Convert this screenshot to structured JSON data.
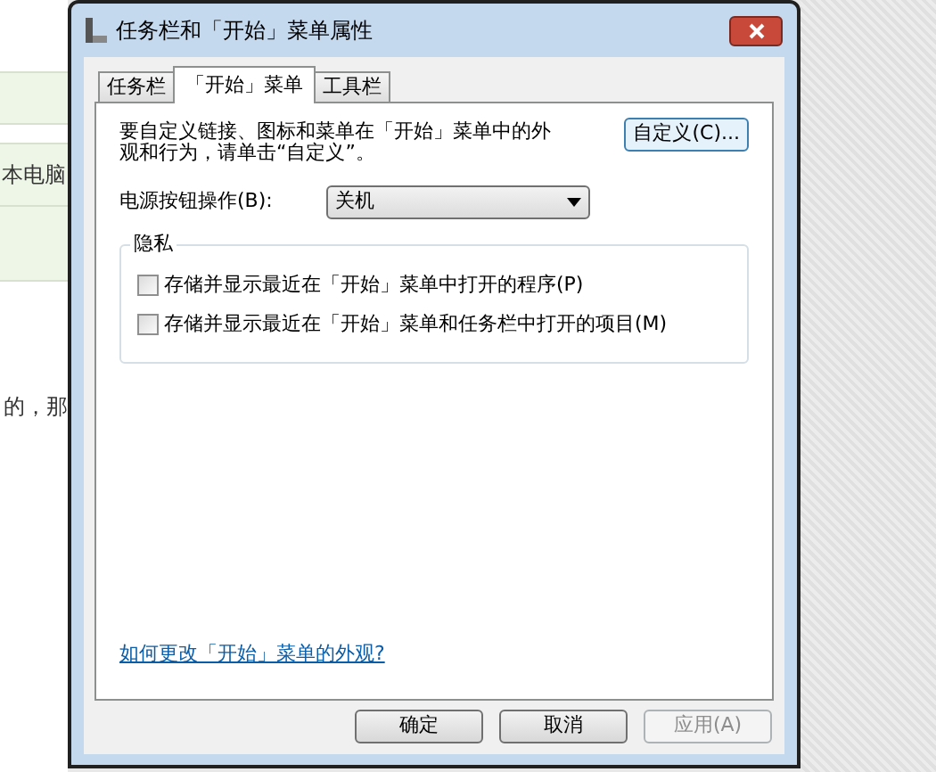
{
  "background_page": {
    "texts": [
      "本电脑",
      "的，那"
    ]
  },
  "window": {
    "title": "任务栏和「开始」菜单属性"
  },
  "tabs": [
    {
      "label": "任务栏",
      "selected": false
    },
    {
      "label": "「开始」菜单",
      "selected": true
    },
    {
      "label": "工具栏",
      "selected": false
    }
  ],
  "customize": {
    "description": "要自定义链接、图标和菜单在「开始」菜单中的外观和行为，请单击“自定义”。",
    "button": "自定义(C)..."
  },
  "power_button": {
    "label": "电源按钮操作(B):",
    "value": "关机"
  },
  "privacy": {
    "title": "隐私",
    "options": [
      {
        "label": "存储并显示最近在「开始」菜单中打开的程序(P)",
        "checked": false
      },
      {
        "label": "存储并显示最近在「开始」菜单和任务栏中打开的项目(M)",
        "checked": false
      }
    ]
  },
  "help_link": "如何更改「开始」菜单的外观?",
  "buttons": [
    {
      "label": "确定",
      "disabled": false
    },
    {
      "label": "取消",
      "disabled": false
    },
    {
      "label": "应用(A)",
      "disabled": true
    }
  ]
}
